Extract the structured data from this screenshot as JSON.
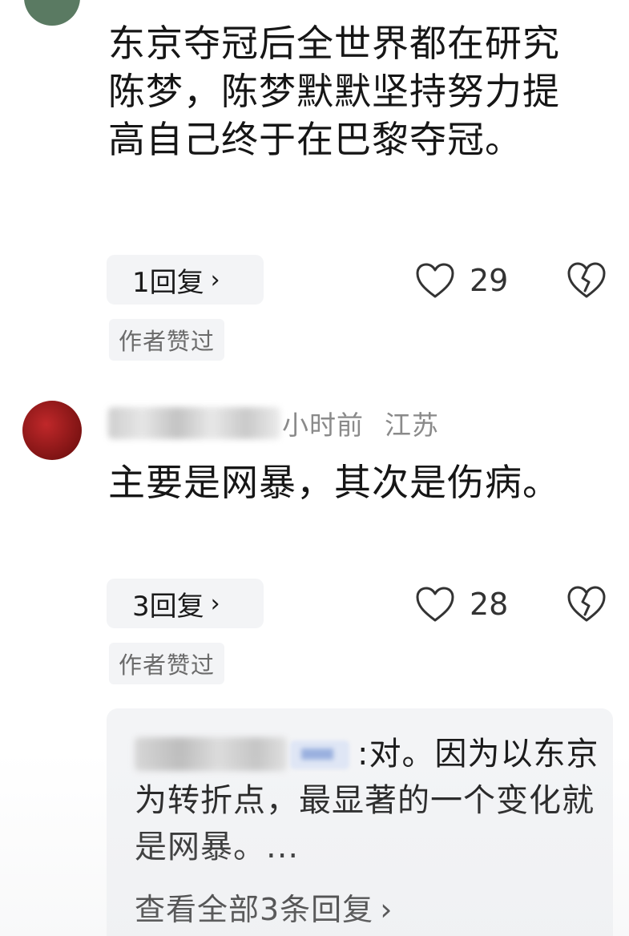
{
  "comments": [
    {
      "text": "东京夺冠后全世界都在研究陈梦，陈梦默默坚持努力提高自己终于在巴黎夺冠。",
      "reply_button": "1回复",
      "likes": "29",
      "author_badge": "作者赞过"
    },
    {
      "time": "小时前",
      "location": "江苏",
      "text": "主要是网暴，其次是伤病。",
      "reply_button": "3回复",
      "likes": "28",
      "author_badge": "作者赞过",
      "reply_preview": {
        "text": ":对。因为以东京为转折点，最显著的一个变化就是网暴。...",
        "view_all": "查看全部3条回复"
      }
    }
  ],
  "icons": {
    "like": "heart-outline-icon",
    "dislike": "broken-heart-icon",
    "chevron": "chevron-right-icon"
  },
  "colors": {
    "pill_bg": "#f3f4f6",
    "meta_text": "#8a8a8a",
    "avatar2": "#c0282a"
  }
}
